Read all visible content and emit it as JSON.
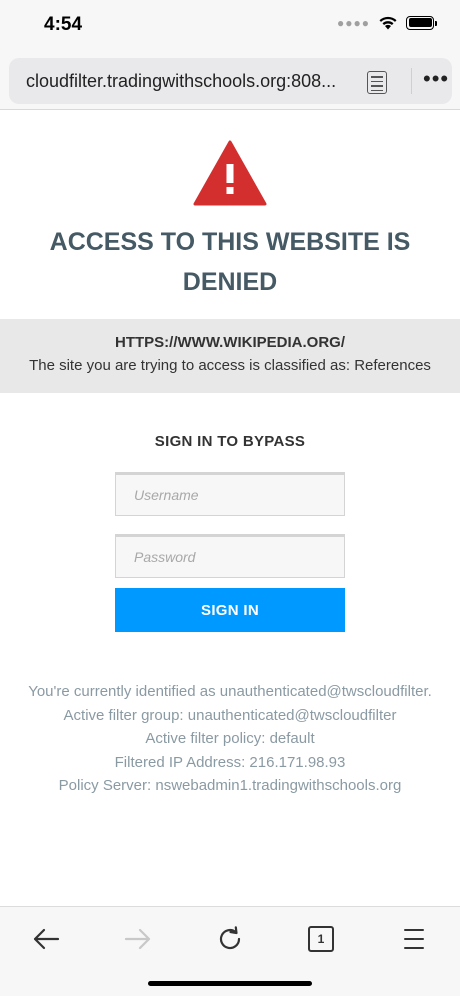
{
  "status_bar": {
    "time": "4:54",
    "icons": [
      "cellular-dots-icon",
      "wifi-icon",
      "battery-icon"
    ]
  },
  "browser": {
    "url": "cloudfilter.tradingwithschools.org:808...",
    "icons": [
      "reader-mode-icon",
      "more-options-icon"
    ]
  },
  "page": {
    "warning_icon": "warning-triangle-icon",
    "title_line1": "ACCESS TO THIS WEBSITE IS",
    "title_line2": "DENIED",
    "blocked_url": "HTTPS://WWW.WIKIPEDIA.ORG/",
    "classification": "The site you are trying to access is classified as: References",
    "signin_heading": "SIGN IN TO BYPASS",
    "username_placeholder": "Username",
    "password_placeholder": "Password",
    "signin_button": "SIGN IN",
    "details": [
      "You're currently identified as unauthenticated@twscloudfilter.",
      "Active filter group: unauthenticated@twscloudfilter",
      "Active filter policy: default",
      "Filtered IP Address: 216.171.98.93",
      "Policy Server: nswebadmin1.tradingwithschools.org"
    ]
  },
  "toolbar": {
    "tab_count": "1",
    "icons": [
      "back-arrow-icon",
      "forward-arrow-icon",
      "reload-icon",
      "tabs-icon",
      "menu-icon"
    ]
  },
  "colors": {
    "warning_red": "#d32f2f",
    "title": "#455a64",
    "button_blue": "#0099ff",
    "details_text": "#8a9aa3",
    "band_bg": "#e8e8e8"
  }
}
